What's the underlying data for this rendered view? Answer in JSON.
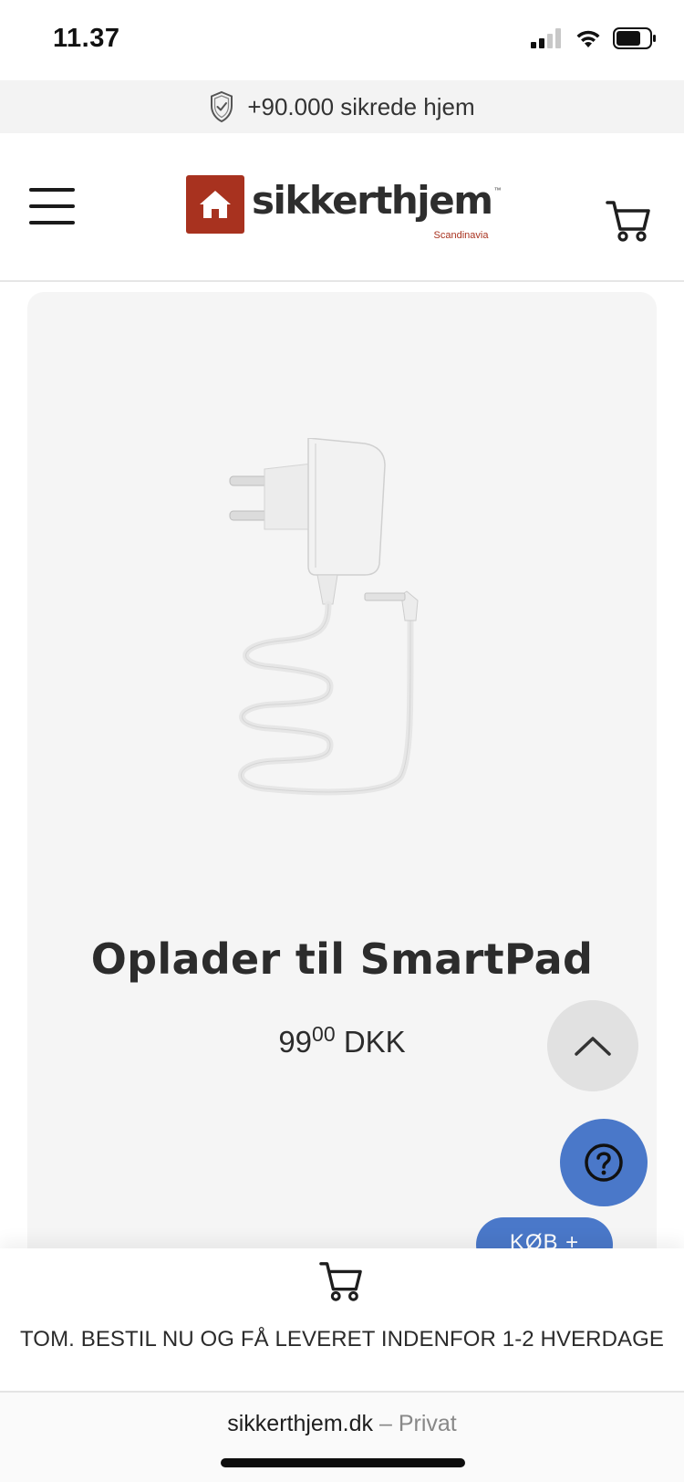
{
  "status_bar": {
    "time": "11.37",
    "icons": [
      "signal-icon",
      "wifi-icon",
      "battery-icon"
    ]
  },
  "trust_bar": {
    "icon": "shield-check-icon",
    "text": "+90.000 sikrede hjem"
  },
  "header": {
    "menu_icon": "hamburger-menu-icon",
    "logo": {
      "wordmark": "sikkerthjem",
      "tm": "™",
      "subtitle": "Scandinavia",
      "brand_color": "#a8321f"
    },
    "cart_icon": "shopping-cart-icon"
  },
  "product": {
    "title": "Oplader til SmartPad",
    "price_integer": "99",
    "price_decimal": "00",
    "currency": "DKK",
    "image": "white-power-adapter-with-cable"
  },
  "floating": {
    "scroll_top_icon": "chevron-up-icon",
    "help_icon": "question-mark-icon",
    "buy_label": "KØB +",
    "accent_color": "#4a78c9"
  },
  "cart_bar": {
    "icon": "shopping-cart-icon",
    "text": "TOM. BESTIL NU OG FÅ LEVERET INDENFOR 1-2 HVERDAGE"
  },
  "browser": {
    "domain": "sikkerthjem.dk",
    "separator": "–",
    "mode": "Privat"
  }
}
